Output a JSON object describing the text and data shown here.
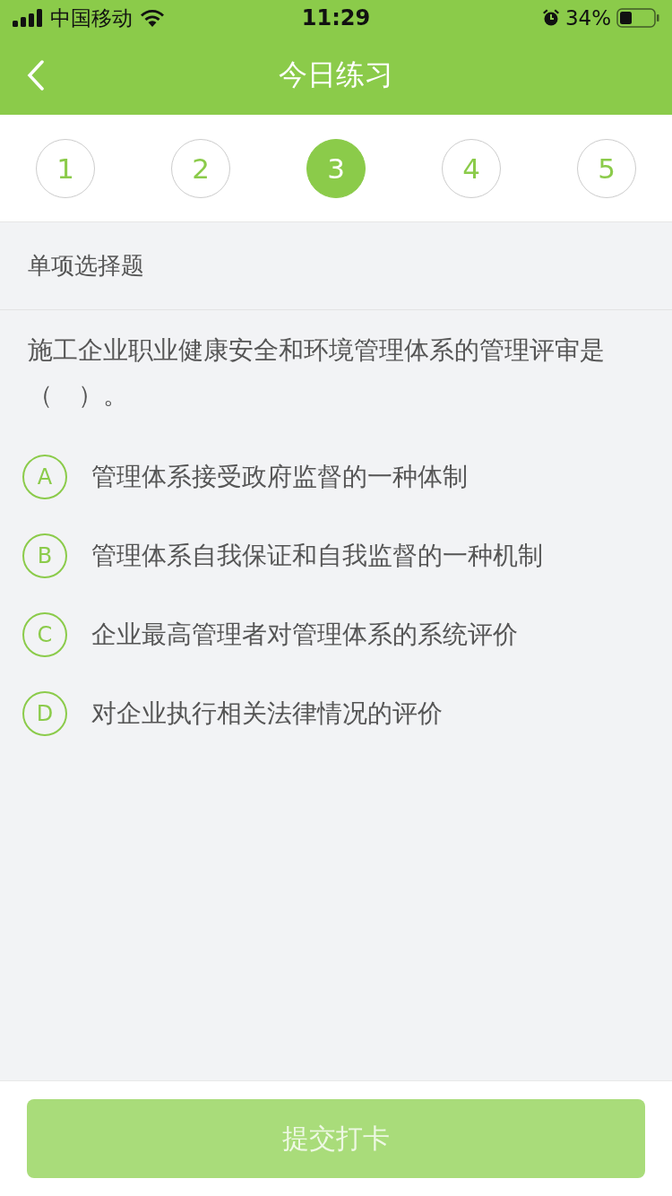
{
  "status_bar": {
    "carrier": "中国移动",
    "time": "11:29",
    "battery": "34%"
  },
  "nav": {
    "title": "今日练习"
  },
  "steps": [
    {
      "label": "1",
      "selected": false
    },
    {
      "label": "2",
      "selected": false
    },
    {
      "label": "3",
      "selected": true
    },
    {
      "label": "4",
      "selected": false
    },
    {
      "label": "5",
      "selected": false
    }
  ],
  "question_type": "单项选择题",
  "question": "施工企业职业健康安全和环境管理体系的管理评审是（　）。",
  "options": [
    {
      "letter": "A",
      "text": "管理体系接受政府监督的一种体制",
      "selected": false
    },
    {
      "letter": "B",
      "text": "管理体系自我保证和自我监督的一种机制",
      "selected": false
    },
    {
      "letter": "C",
      "text": "企业最高管理者对管理体系的系统评价",
      "selected": false
    },
    {
      "letter": "D",
      "text": "对企业执行相关法律情况的评价",
      "selected": false
    }
  ],
  "submit": {
    "label": "提交打卡",
    "disabled": true
  }
}
